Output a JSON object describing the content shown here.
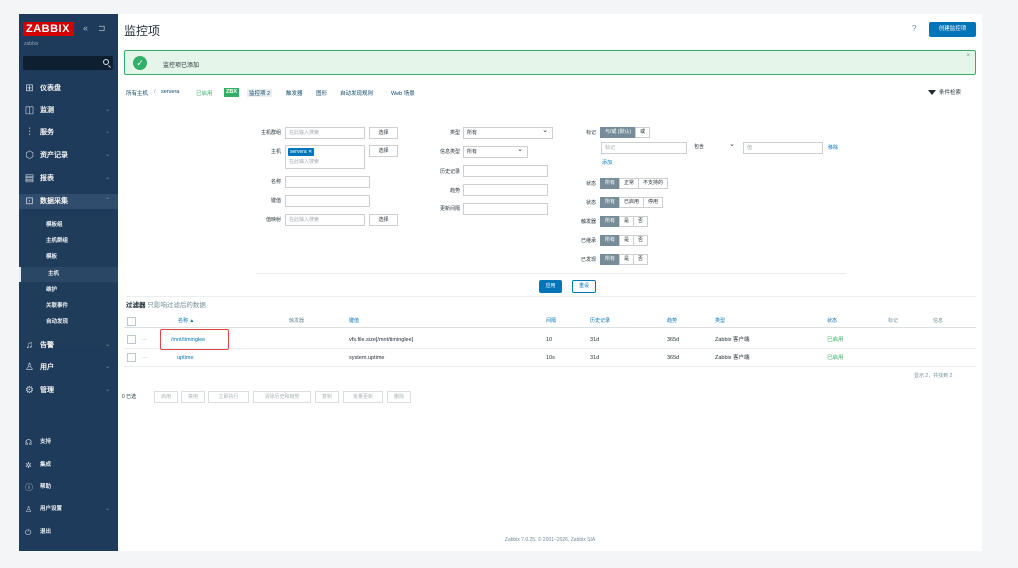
{
  "sidebar": {
    "logo": "ZABBIX",
    "collapse": "«",
    "kiosk": "⊐",
    "server": "zabbix",
    "search_placeholder": "",
    "items": [
      {
        "label": "仪表盘",
        "icon": "dashboard-icon"
      },
      {
        "label": "监测",
        "icon": "monitoring-icon"
      },
      {
        "label": "服务",
        "icon": "services-icon"
      },
      {
        "label": "资产记录",
        "icon": "inventory-icon"
      },
      {
        "label": "报表",
        "icon": "reports-icon"
      },
      {
        "label": "数据采集",
        "icon": "data-collection-icon"
      }
    ],
    "sub_items": [
      "模板组",
      "主机群组",
      "模板",
      "主机",
      "维护",
      "关联事件",
      "自动发现"
    ],
    "items2": [
      {
        "label": "告警",
        "icon": "alerts-icon"
      },
      {
        "label": "用户",
        "icon": "users-icon"
      },
      {
        "label": "管理",
        "icon": "admin-icon"
      }
    ],
    "bottom": [
      {
        "label": "支持",
        "icon": "support-icon"
      },
      {
        "label": "集成",
        "icon": "integrations-icon"
      },
      {
        "label": "帮助",
        "icon": "help-icon"
      },
      {
        "label": "用户设置",
        "icon": "user-settings-icon"
      },
      {
        "label": "退出",
        "icon": "logout-icon"
      }
    ],
    "chevron": "⌄"
  },
  "header": {
    "title": "监控项",
    "help": "?",
    "create_button": "创建监控项"
  },
  "message": {
    "text": "监控项已添加",
    "close": "×"
  },
  "breadcrumb": {
    "all_hosts": "所有主机",
    "sep": "/",
    "host": "servera",
    "enabled": "已启用",
    "zbx": "ZBX",
    "items": "监控项 2",
    "triggers": "触发器",
    "graphs": "图形",
    "discovery": "自动发现规则",
    "web": "Web 场景"
  },
  "filter_toggle": "条件检索",
  "filter": {
    "host_groups_label": "主机群组",
    "host_groups_placeholder": "在此输入搜索",
    "select": "选择",
    "hosts_label": "主机",
    "host_tag": "servera",
    "host_tag_x": "✕",
    "hosts_placeholder": "在此输入搜索",
    "name_label": "名称",
    "key_label": "键值",
    "value_mapping_label": "值映射",
    "value_mapping_placeholder": "在此输入搜索",
    "type_label": "类型",
    "type_value": "所有",
    "info_type_label": "信息类型",
    "info_type_value": "所有",
    "history_label": "历史记录",
    "trends_label": "趋势",
    "interval_label": "更新间隔",
    "tags_label": "标记",
    "tags_mode": [
      "与/或 (默认)",
      "或"
    ],
    "tag_placeholder": "标记",
    "tag_op": "包含",
    "tag_value_placeholder": "值",
    "remove": "移除",
    "add": "添加",
    "state_label": "状态",
    "state_opts": [
      "所有",
      "正常",
      "不支持的"
    ],
    "status_label": "状态",
    "status_opts": [
      "所有",
      "已启用",
      "停用"
    ],
    "triggers_label": "触发器",
    "inherited_label": "已继承",
    "discovered_label": "已发现",
    "yn_opts": [
      "所有",
      "是",
      "否"
    ],
    "apply": "应用",
    "reset": "重设"
  },
  "filter_note": {
    "bold": "过滤器",
    "rest": "只影响过滤后的数据"
  },
  "table": {
    "columns": [
      "名称 ▲",
      "触发器",
      "键值",
      "间隔",
      "历史记录",
      "趋势",
      "类型",
      "状态",
      "标记",
      "信息"
    ],
    "rows": [
      {
        "menu": "···",
        "name": "/mnt/timinglee",
        "trigger": "",
        "key": "vfs.file.size[/mnt/timinglee]",
        "interval": "10",
        "history": "31d",
        "trends": "365d",
        "type": "Zabbix 客户端",
        "status": "已启用"
      },
      {
        "menu": "···",
        "name": "uptime",
        "trigger": "",
        "key": "system.uptime",
        "interval": "10s",
        "history": "31d",
        "trends": "365d",
        "type": "Zabbix 客户端",
        "status": "已启用"
      }
    ],
    "count": "显示 2，共找到 2"
  },
  "mass": {
    "selected": "0 已选",
    "buttons": [
      "启用",
      "禁用",
      "立即执行",
      "清除历史和趋势",
      "复制",
      "批量更新",
      "删除"
    ]
  },
  "footer": "Zabbix 7.0.25. © 2001–2026, Zabbix SIA",
  "colors": {
    "sidebar": "#1f3b5b",
    "accent": "#0275b8",
    "success": "#34af67",
    "logo": "#d40000"
  }
}
